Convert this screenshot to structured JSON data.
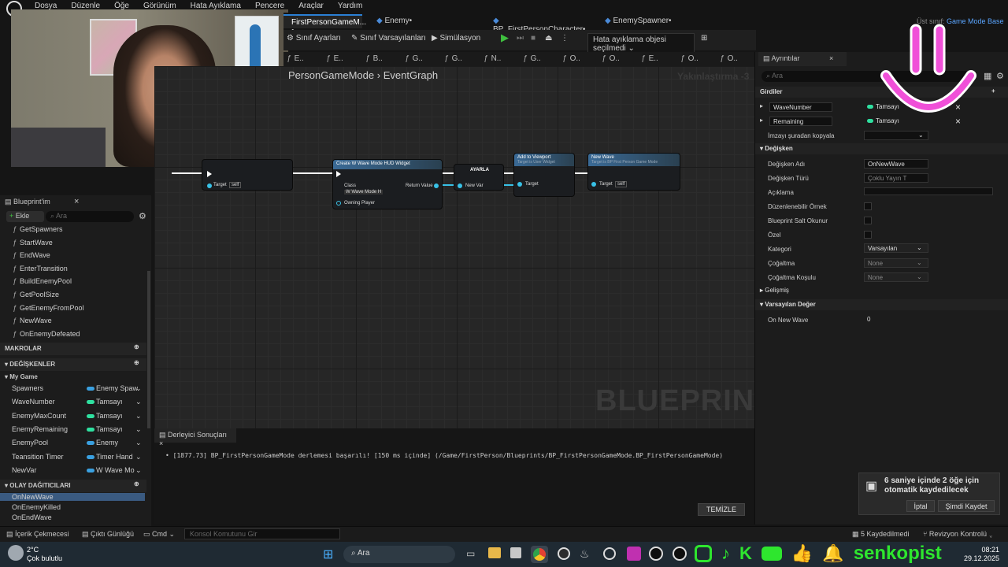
{
  "menu": [
    "Dosya",
    "Düzenle",
    "Öğe",
    "Görünüm",
    "Hata Ayıklama",
    "Pencere",
    "Araçlar",
    "Yardım"
  ],
  "tabs": [
    {
      "label": "FirstPersonGameM... •"
    },
    {
      "label": "Enemy•"
    },
    {
      "label": "BP_FirstPersonCharacter•"
    },
    {
      "label": "EnemySpawner•"
    }
  ],
  "parent_class": {
    "label": "Üst sınıf:",
    "value": "Game Mode Base"
  },
  "toolbar": {
    "class_settings": "Sınıf Ayarları",
    "class_defaults": "Sınıf Varsayılanları",
    "simulation": "Simülasyon",
    "debug_select": "Hata ayıklama objesi seçilmedi"
  },
  "graph_tabs": [
    "E..",
    "E..",
    "B..",
    "G..",
    "G..",
    "N..",
    "G..",
    "O..",
    "O..",
    "E..",
    "O..",
    "O.."
  ],
  "breadcrumb": {
    "class": "PersonGameMode",
    "sep": "›",
    "graph": "EventGraph"
  },
  "zoom": "Yakınlaştırma -3",
  "watermark": "BLUEPRINT",
  "nodes": {
    "create_widget": {
      "title": "Create W Wave Mode HUD Widget",
      "class_label": "Class",
      "class_value": "W Wave Mode H",
      "return": "Return Value",
      "owning": "Owning Player"
    },
    "set": {
      "title": "AYARLA",
      "pin": "New Var"
    },
    "add_viewport": {
      "title": "Add to Viewport",
      "sub": "Target is User Widget",
      "target": "Target"
    },
    "new_wave": {
      "title": "New Wave",
      "sub": "Target is BP First Person Game Mode",
      "target": "Target",
      "self": "self"
    },
    "left_target": {
      "target": "Target",
      "self": "self"
    }
  },
  "blueprint_panel": {
    "title": "Blueprint'im",
    "add": "Ekle",
    "search_placeholder": "Ara",
    "functions": [
      "GetSpawners",
      "StartWave",
      "EndWave",
      "EnterTransition",
      "BuildEnemyPool",
      "GetPoolSize",
      "GetEnemyFromPool",
      "NewWave",
      "OnEnemyDefeated"
    ],
    "macros": "MAKROLAR",
    "variables_title": "DEĞİŞKENLER",
    "my_game": "My Game",
    "variables": [
      {
        "name": "Spawners",
        "type": "Enemy Spaw",
        "color": "#3aa0e0"
      },
      {
        "name": "WaveNumber",
        "type": "Tamsayı",
        "color": "#2fe0a0"
      },
      {
        "name": "EnemyMaxCount",
        "type": "Tamsayı",
        "color": "#2fe0a0"
      },
      {
        "name": "EnemyRemaining",
        "type": "Tamsayı",
        "color": "#2fe0a0"
      },
      {
        "name": "EnemyPool",
        "type": "Enemy",
        "color": "#3aa0e0"
      },
      {
        "name": "Teansition Timer",
        "type": "Timer Hand",
        "color": "#3aa0e0"
      },
      {
        "name": "NewVar",
        "type": "W Wave Mo",
        "color": "#3aa0e0"
      }
    ],
    "dispatchers_title": "OLAY DAĞITICILARI",
    "dispatchers": [
      "OnNewWave",
      "OnEnemyKilled",
      "OnEndWave"
    ]
  },
  "details": {
    "title": "Ayrıntılar",
    "search_placeholder": "Ara",
    "inputs_title": "Girdiler",
    "inputs": [
      {
        "name": "WaveNumber",
        "type": "Tamsayı"
      },
      {
        "name": "Remaining",
        "type": "Tamsayı"
      }
    ],
    "copy_sig": "İmzayı şuradan kopyala",
    "variable_title": "Değişken",
    "var_name_label": "Değişken Adı",
    "var_name": "OnNewWave",
    "var_type_label": "Değişken Türü",
    "var_type": "Çoklu Yayın T",
    "desc_label": "Açıklama",
    "editable_label": "Düzenlenebilir Örnek",
    "readonly_label": "Blueprint Salt Okunur",
    "private_label": "Özel",
    "category_label": "Kategori",
    "category": "Varsayılan",
    "replication_label": "Çoğaltma",
    "replication": "None",
    "rep_cond_label": "Çoğaltma Koşulu",
    "rep_cond": "None",
    "advanced": "Gelişmiş",
    "default_title": "Varsayılan Değer",
    "default_name": "On New Wave",
    "default_value": "0"
  },
  "compiler": {
    "tab": "Derleyici Sonuçları",
    "message": "[1877.73] BP_FirstPersonGameMode derlemesi başarılı! [150 ms içinde] (/Game/FirstPerson/Blueprints/BP_FirstPersonGameMode.BP_FirstPersonGameMode)",
    "clear": "TEMİZLE"
  },
  "toast": {
    "text": "6 saniye içinde 2 öğe için otomatik kaydedilecek",
    "ignore": "İptal",
    "save": "Şimdi Kaydet"
  },
  "statusbar": {
    "content": "İçerik Çekmecesi",
    "output": "Çıktı Günlüğü",
    "cmd": "Cmd",
    "console_placeholder": "Konsol Komutunu Gir",
    "unsaved": "5 Kaydedilmedi",
    "revision": "Revizyon Kontrolü"
  },
  "taskbar": {
    "temp": "2°C",
    "weather": "Çok bulutlu",
    "search": "Ara",
    "time": "08:21",
    "date": "29.12.2025",
    "channel": "senkopist"
  }
}
